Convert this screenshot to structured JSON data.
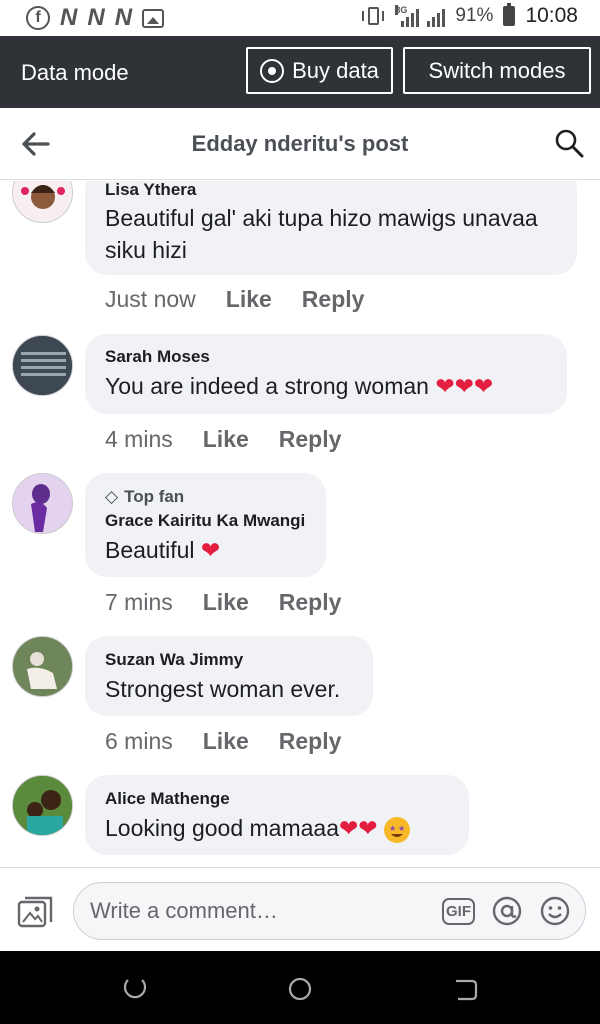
{
  "status_bar": {
    "battery": "91%",
    "time": "10:08",
    "network": "3G",
    "icons": [
      "facebook-icon",
      "notification-n-icon",
      "notification-n-icon",
      "notification-n-icon",
      "gallery-icon",
      "vibrate-icon",
      "signal-icon",
      "battery-icon"
    ]
  },
  "data_bar": {
    "title": "Data mode",
    "buy_label": "Buy data",
    "switch_label": "Switch modes"
  },
  "header": {
    "title": "Edday nderitu's post"
  },
  "comments": [
    {
      "name": "Lisa Ythera",
      "text_lines": [
        "Beautiful gal' aki tupa hizo mawigs unavaa",
        "siku hizi"
      ],
      "time": "Just now",
      "like": "Like",
      "reply": "Reply"
    },
    {
      "name": "Sarah Moses",
      "text": "You are indeed a strong woman",
      "emoji": "❤❤❤",
      "time": "4 mins",
      "like": "Like",
      "reply": "Reply"
    },
    {
      "badge": "Top fan",
      "name": "Grace Kairitu Ka Mwangi",
      "text": "Beautiful",
      "emoji": "❤",
      "time": "7 mins",
      "like": "Like",
      "reply": "Reply"
    },
    {
      "name": "Suzan Wa Jimmy",
      "text": "Strongest woman ever.",
      "time": "6 mins",
      "like": "Like",
      "reply": "Reply"
    },
    {
      "name": "Alice Mathenge",
      "text": "Looking good mamaaa",
      "emoji": "❤❤",
      "emoji_extra": "star-struck-emoji"
    }
  ],
  "composer": {
    "placeholder": "Write a comment…",
    "gif_label": "GIF"
  },
  "colors": {
    "data_bar_bg": "#2f3237",
    "bubble_bg": "#f0f2f5",
    "heart": "#e41e3f",
    "meta_text": "#65676b"
  }
}
